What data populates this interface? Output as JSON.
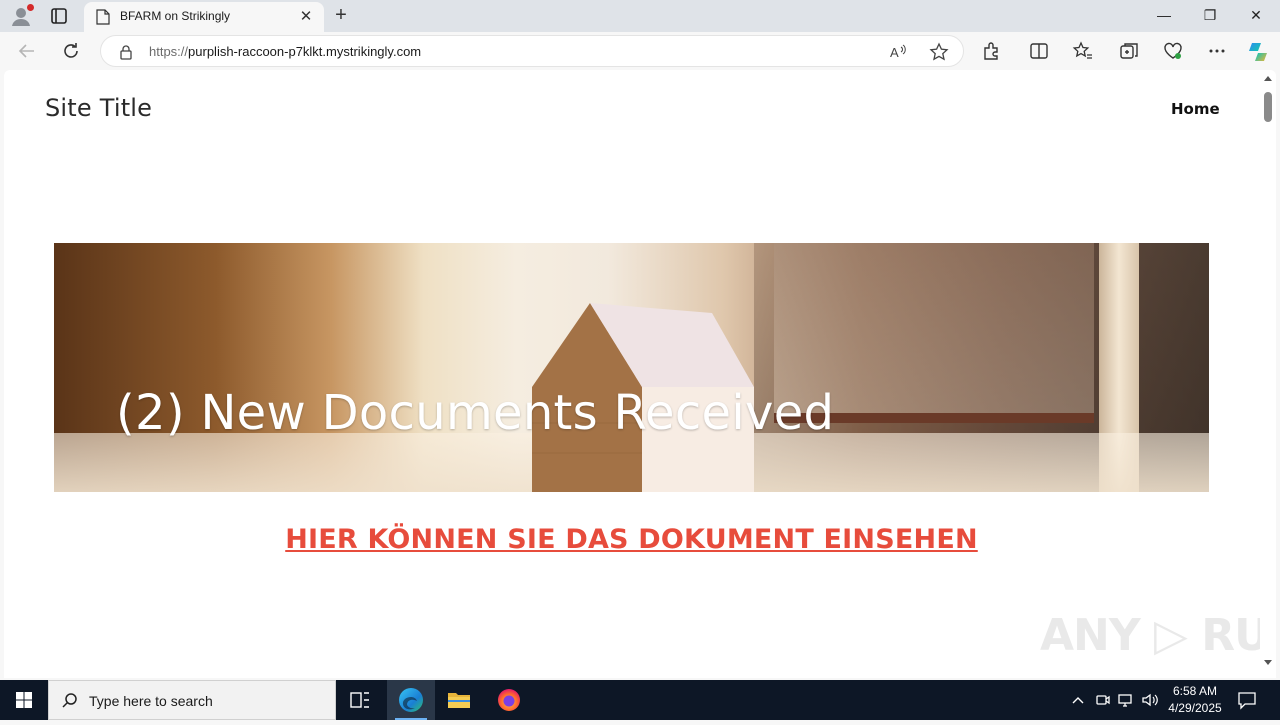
{
  "browser": {
    "tab": {
      "title": "BFARM on Strikingly"
    },
    "new_tab": "+",
    "close_tab": "✕",
    "window": {
      "minimize": "—",
      "restore": "❐",
      "close": "✕"
    },
    "address": {
      "prefix": "https://",
      "domain": "purplish-raccoon-p7klkt.mystrikingly.com"
    }
  },
  "page": {
    "site_title": "Site Title",
    "nav": [
      {
        "label": "Home"
      }
    ],
    "hero": {
      "text": "(2) New Documents Received"
    },
    "cta": {
      "label": "HIER KÖNNEN SIE DAS DOKUMENT EINSEHEN"
    }
  },
  "watermark": "ANY ▷ RUN",
  "taskbar": {
    "search_placeholder": "Type here to search",
    "clock": {
      "time": "6:58 AM",
      "date": "4/29/2025"
    }
  },
  "colors": {
    "cta": "#e74c3c",
    "taskbar": "#0d1726",
    "chrome": "#dfe3e8"
  }
}
